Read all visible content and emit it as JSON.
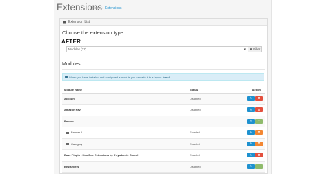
{
  "header": {
    "title": "Extensions",
    "breadcrumb": [
      "Home",
      "Extensions"
    ]
  },
  "panel": {
    "heading": "Extension List",
    "choose_label": "Choose the extension type",
    "select_value": "Modules (27)",
    "filter_label": "Filter",
    "after_label": "AFTER",
    "section_title": "Modules",
    "info_text": "When you have installed and configured a module you can add it to a layout",
    "info_link": "here!"
  },
  "table": {
    "headers": [
      "Module Name",
      "Status",
      "Action"
    ],
    "rows": [
      {
        "name": "Account",
        "status": "Disabled",
        "child": false,
        "btn1": "edit",
        "btn2": "del"
      },
      {
        "name": "Amazon Pay",
        "status": "Disabled",
        "child": false,
        "btn1": "edit",
        "btn2": "del"
      },
      {
        "name": "Banner",
        "status": "",
        "child": false,
        "btn1": "edit",
        "btn2": "add"
      },
      {
        "name": "Banner 1",
        "status": "Enabled",
        "child": true,
        "btn1": "edit",
        "btn2": "warn"
      },
      {
        "name": "Category",
        "status": "Enabled",
        "child": true,
        "btn1": "edit",
        "btn2": "warn"
      },
      {
        "name": "Base Plugin - HumBee Extensions by Priyadarsie Gharel",
        "status": "Enabled",
        "child": false,
        "btn1": "edit",
        "btn2": "del"
      },
      {
        "name": "Bestsellers",
        "status": "Disabled",
        "child": false,
        "btn1": "edit",
        "btn2": "add"
      }
    ]
  },
  "colors": {
    "edit": "#1e91cf",
    "delete": "#e3503e",
    "install": "#8fbb6c",
    "warning": "#f38733",
    "info_bg": "#d9edf7"
  }
}
